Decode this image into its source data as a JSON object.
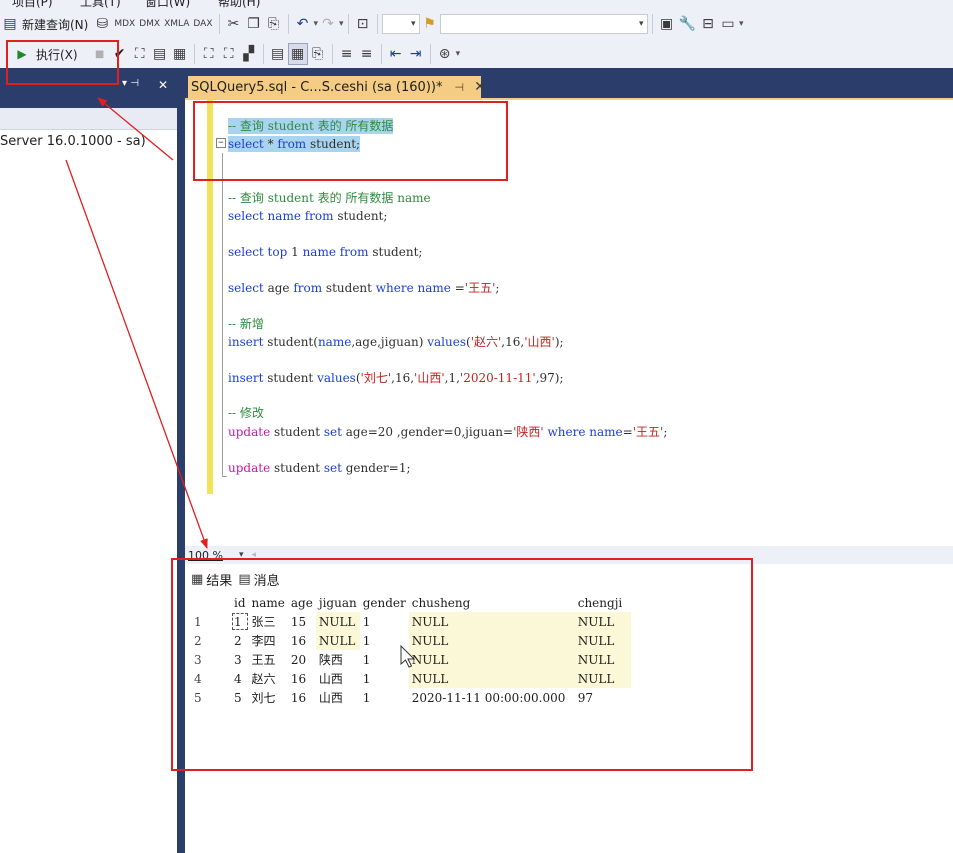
{
  "menu": {
    "items": [
      "项目(P)",
      "工具(T)",
      "窗口(W)",
      "帮助(H)"
    ]
  },
  "toolbar1": {
    "new_query_label": "新建查询(N)",
    "db_labels": [
      "MDX",
      "DMX",
      "XMLA",
      "DAX"
    ]
  },
  "toolbar2": {
    "execute_label": "执行(X)"
  },
  "explorer": {
    "pin": "▾ ⊣",
    "close": "✕",
    "server_node": "Server 16.0.1000 - sa)"
  },
  "editor": {
    "tab_title": "SQLQuery5.sql - C...S.ceshi (sa (160))*",
    "tab_pin": "⊣",
    "tab_close": "✕",
    "zoom": "100 %",
    "lines": [
      {
        "parts": [
          {
            "t": "-- 查询 student 表的 所有数据",
            "c": "cm"
          }
        ]
      },
      {
        "parts": [
          {
            "t": "select",
            "c": "kw"
          },
          {
            "t": " * ",
            "c": "tx"
          },
          {
            "t": "from",
            "c": "kw"
          },
          {
            "t": " student;",
            "c": "tx"
          }
        ]
      },
      {
        "parts": [
          {
            "t": "-- 查询 student 表的 所有数据 name",
            "c": "cm"
          }
        ]
      },
      {
        "parts": [
          {
            "t": "select name ",
            "c": "kw"
          },
          {
            "t": "from",
            "c": "kw"
          },
          {
            "t": " student;",
            "c": "tx"
          }
        ]
      },
      {
        "parts": [
          {
            "t": "select top ",
            "c": "kw"
          },
          {
            "t": "1 ",
            "c": "tx"
          },
          {
            "t": "name from",
            "c": "kw"
          },
          {
            "t": " student;",
            "c": "tx"
          }
        ]
      },
      {
        "parts": [
          {
            "t": "select",
            "c": "kw"
          },
          {
            "t": " age ",
            "c": "tx"
          },
          {
            "t": "from",
            "c": "kw"
          },
          {
            "t": " student ",
            "c": "tx"
          },
          {
            "t": "where name",
            "c": "kw"
          },
          {
            "t": " =",
            "c": "tx"
          },
          {
            "t": "'王五'",
            "c": "st"
          },
          {
            "t": ";",
            "c": "tx"
          }
        ]
      },
      {
        "parts": [
          {
            "t": "-- 新增",
            "c": "cm"
          }
        ]
      },
      {
        "parts": [
          {
            "t": "insert",
            "c": "kw"
          },
          {
            "t": " student(",
            "c": "tx"
          },
          {
            "t": "name",
            "c": "kw"
          },
          {
            "t": ",age,jiguan) ",
            "c": "tx"
          },
          {
            "t": "values",
            "c": "kw"
          },
          {
            "t": "(",
            "c": "tx"
          },
          {
            "t": "'赵六'",
            "c": "st"
          },
          {
            "t": ",16,",
            "c": "tx"
          },
          {
            "t": "'山西'",
            "c": "st"
          },
          {
            "t": ");",
            "c": "tx"
          }
        ]
      },
      {
        "parts": [
          {
            "t": "insert",
            "c": "kw"
          },
          {
            "t": " student ",
            "c": "tx"
          },
          {
            "t": "values",
            "c": "kw"
          },
          {
            "t": "(",
            "c": "tx"
          },
          {
            "t": "'刘七'",
            "c": "st"
          },
          {
            "t": ",16,",
            "c": "tx"
          },
          {
            "t": "'山西'",
            "c": "st"
          },
          {
            "t": ",1,",
            "c": "tx"
          },
          {
            "t": "'2020-11-11'",
            "c": "st"
          },
          {
            "t": ",97);",
            "c": "tx"
          }
        ]
      },
      {
        "parts": [
          {
            "t": "-- 修改",
            "c": "cm"
          }
        ]
      },
      {
        "parts": [
          {
            "t": "update",
            "c": "pk"
          },
          {
            "t": " student ",
            "c": "tx"
          },
          {
            "t": "set",
            "c": "kw"
          },
          {
            "t": " age=20 ,gender=0,jiguan=",
            "c": "tx"
          },
          {
            "t": "'陕西'",
            "c": "st"
          },
          {
            "t": " ",
            "c": "tx"
          },
          {
            "t": "where name",
            "c": "kw"
          },
          {
            "t": "=",
            "c": "tx"
          },
          {
            "t": "'王五'",
            "c": "st"
          },
          {
            "t": ";",
            "c": "tx"
          }
        ]
      },
      {
        "parts": [
          {
            "t": "update",
            "c": "pk"
          },
          {
            "t": " student ",
            "c": "tx"
          },
          {
            "t": "set",
            "c": "kw"
          },
          {
            "t": " gender=1;",
            "c": "tx"
          }
        ]
      }
    ]
  },
  "results": {
    "tab_results": "结果",
    "tab_messages": "消息",
    "columns": [
      "id",
      "name",
      "age",
      "jiguan",
      "gender",
      "chusheng",
      "chengji"
    ],
    "rows": [
      [
        "1",
        "1",
        "张三",
        "15",
        "NULL",
        "1",
        "NULL",
        "NULL"
      ],
      [
        "2",
        "2",
        "李四",
        "16",
        "NULL",
        "1",
        "NULL",
        "NULL"
      ],
      [
        "3",
        "3",
        "王五",
        "20",
        "陕西",
        "1",
        "NULL",
        "NULL"
      ],
      [
        "4",
        "4",
        "赵六",
        "16",
        "山西",
        "1",
        "NULL",
        "NULL"
      ],
      [
        "5",
        "5",
        "刘七",
        "16",
        "山西",
        "1",
        "2020-11-11 00:00:00.000",
        "97"
      ]
    ]
  },
  "annotation_color": "#e02020"
}
